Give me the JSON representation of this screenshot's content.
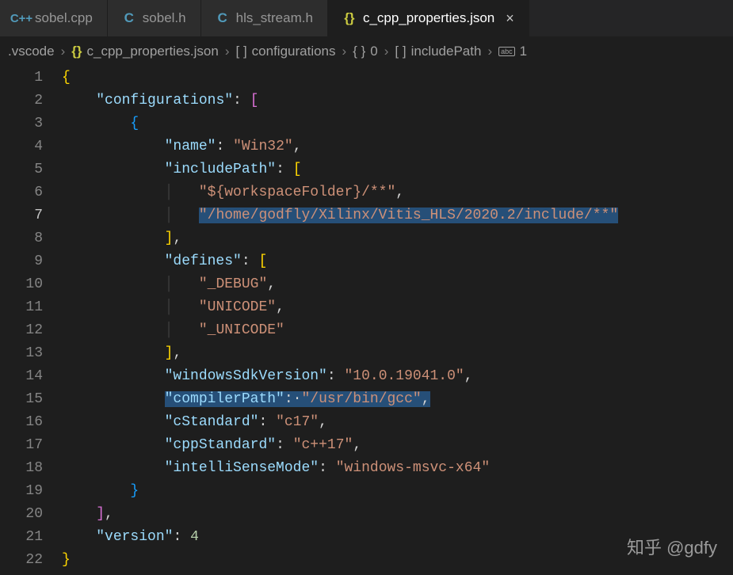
{
  "tabs": {
    "t0": {
      "label": "sobel.cpp",
      "icon": "C++"
    },
    "t1": {
      "label": "sobel.h",
      "icon": "C"
    },
    "t2": {
      "label": "hls_stream.h",
      "icon": "C"
    },
    "t3": {
      "label": "c_cpp_properties.json",
      "icon": "{}"
    }
  },
  "breadcrumb": {
    "b0": ".vscode",
    "b1": "c_cpp_properties.json",
    "b2": "configurations",
    "b3": "0",
    "b4": "includePath",
    "b5": "1"
  },
  "gutter": {
    "l1": "1",
    "l2": "2",
    "l3": "3",
    "l4": "4",
    "l5": "5",
    "l6": "6",
    "l7": "7",
    "l8": "8",
    "l9": "9",
    "l10": "10",
    "l11": "11",
    "l12": "12",
    "l13": "13",
    "l14": "14",
    "l15": "15",
    "l16": "16",
    "l17": "17",
    "l18": "18",
    "l19": "19",
    "l20": "20",
    "l21": "21",
    "l22": "22"
  },
  "code": {
    "configurations_key": "\"configurations\"",
    "name_key": "\"name\"",
    "name_val": "\"Win32\"",
    "includePath_key": "\"includePath\"",
    "includePath_v0": "\"${workspaceFolder}/**\"",
    "includePath_v1": "\"/home/godfly/Xilinx/Vitis_HLS/2020.2/include/**\"",
    "defines_key": "\"defines\"",
    "defines_v0": "\"_DEBUG\"",
    "defines_v1": "\"UNICODE\"",
    "defines_v2": "\"_UNICODE\"",
    "windowsSdk_key": "\"windowsSdkVersion\"",
    "windowsSdk_val": "\"10.0.19041.0\"",
    "compilerPath_key": "\"compilerPath\"",
    "compilerPath_val": "\"/usr/bin/gcc\"",
    "cStandard_key": "\"cStandard\"",
    "cStandard_val": "\"c17\"",
    "cppStandard_key": "\"cppStandard\"",
    "cppStandard_val": "\"c++17\"",
    "intelliSense_key": "\"intelliSenseMode\"",
    "intelliSense_val": "\"windows-msvc-x64\"",
    "version_key": "\"version\"",
    "version_val": "4"
  },
  "watermark": "知乎 @gdfy"
}
